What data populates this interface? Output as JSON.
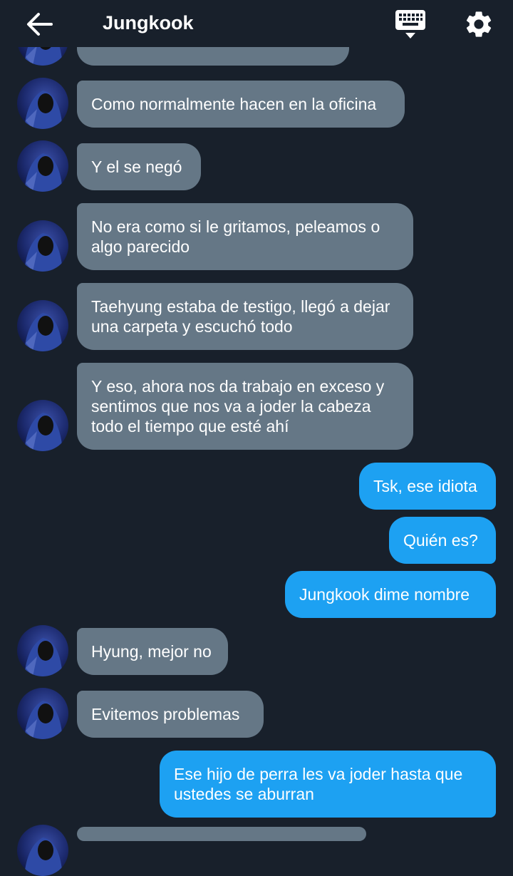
{
  "header": {
    "title": "Jungkook",
    "back_icon": "arrow-left-icon",
    "keyboard_icon": "keyboard-icon",
    "settings_icon": "gear-icon"
  },
  "colors": {
    "background": "#18202b",
    "incoming_bubble": "#657786",
    "outgoing_bubble": "#1da1f2",
    "text": "#ffffff"
  },
  "messages": [
    {
      "from": "them",
      "text": "Como normalmente hacen en la oficina"
    },
    {
      "from": "them",
      "text": "Y el se negó"
    },
    {
      "from": "them",
      "text": "No era como si le gritamos, peleamos o\nalgo parecido"
    },
    {
      "from": "them",
      "text": "Taehyung estaba de testigo, llegó a dejar\nuna carpeta y escuchó todo"
    },
    {
      "from": "them",
      "text": "Y eso, ahora nos da trabajo en exceso y\nsentimos que nos va a joder la cabeza\ntodo el tiempo que esté ahí"
    },
    {
      "from": "me",
      "text": "Tsk, ese idiota"
    },
    {
      "from": "me",
      "text": "Quién es?"
    },
    {
      "from": "me",
      "text": "Jungkook dime nombre"
    },
    {
      "from": "them",
      "text": "Hyung, mejor no"
    },
    {
      "from": "them",
      "text": "Evitemos problemas"
    },
    {
      "from": "me",
      "text": "Ese hijo de perra les va joder hasta que\nustedes se aburran"
    }
  ]
}
